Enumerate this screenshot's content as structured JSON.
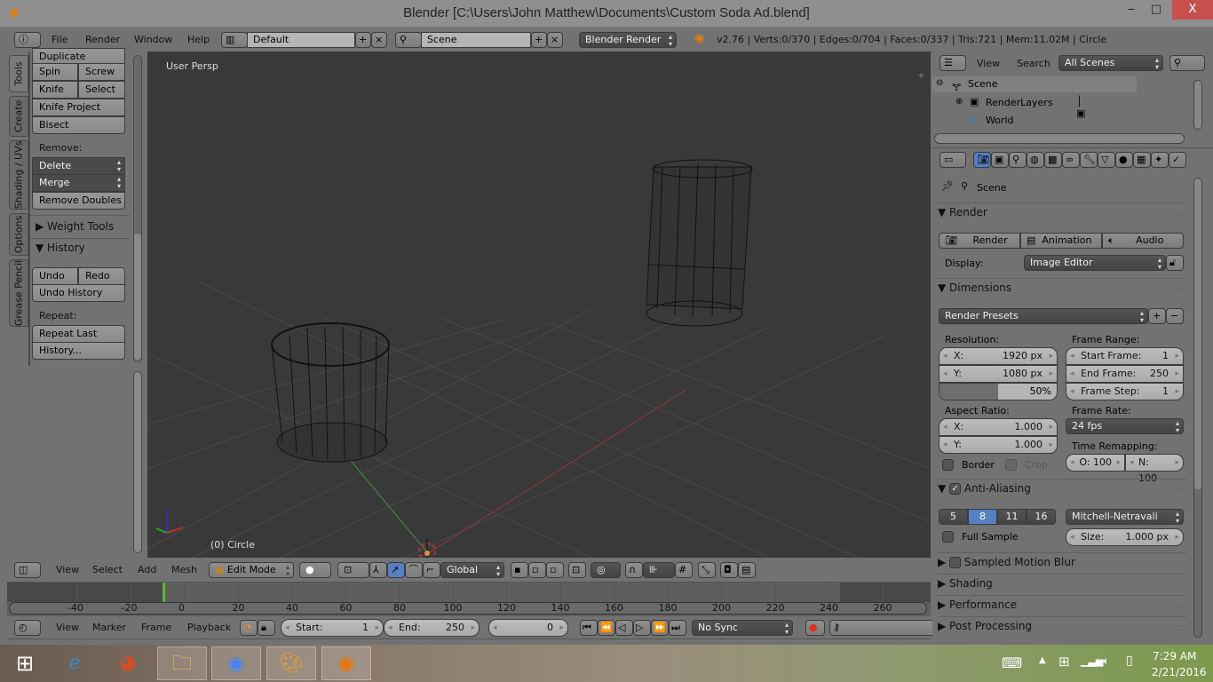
{
  "window": {
    "title": "Blender [C:\\Users\\John Matthew\\Documents\\Custom Soda Ad.blend]",
    "minimize": "‒",
    "maximize": "□",
    "close": "X"
  },
  "info_header": {
    "menus": [
      "File",
      "Render",
      "Window",
      "Help"
    ],
    "screen_layout": "Default",
    "scene": "Scene",
    "engine": "Blender Render",
    "stats": "v2.76 | Verts:0/370 | Edges:0/704 | Faces:0/337 | Tris:721 | Mem:11.02M | Circle"
  },
  "toolshelf": {
    "tabs": [
      "Tools",
      "Create",
      "Shading / UVs",
      "Options",
      "Grease Pencil"
    ],
    "buttons": {
      "duplicate": "Duplicate",
      "spin": "Spin",
      "screw": "Screw",
      "knife": "Knife",
      "select": "Select",
      "knife_project": "Knife Project",
      "bisect": "Bisect"
    },
    "remove_label": "Remove:",
    "delete": "Delete",
    "merge": "Merge",
    "remove_doubles": "Remove Doubles",
    "weight_tools": "Weight Tools",
    "history": "History",
    "undo": "Undo",
    "redo": "Redo",
    "undo_history": "Undo History",
    "repeat_label": "Repeat:",
    "repeat_last": "Repeat Last",
    "history_dots": "History..."
  },
  "viewport": {
    "view_label": "User Persp",
    "object_label": "(0) Circle"
  },
  "view3d_header": {
    "menus": [
      "View",
      "Select",
      "Add",
      "Mesh"
    ],
    "mode": "Edit Mode",
    "orientation": "Global"
  },
  "timeline": {
    "ticks": [
      "-40",
      "-20",
      "0",
      "20",
      "40",
      "60",
      "80",
      "100",
      "120",
      "140",
      "160",
      "180",
      "200",
      "220",
      "240",
      "260"
    ],
    "current_frame": "0",
    "menus": [
      "View",
      "Marker",
      "Frame",
      "Playback"
    ],
    "start_label": "Start:",
    "start": "1",
    "end_label": "End:",
    "end": "250",
    "sync": "No Sync"
  },
  "outliner": {
    "menus": [
      "View",
      "Search"
    ],
    "filter": "All Scenes",
    "items": [
      "Scene",
      "RenderLayers",
      "World"
    ]
  },
  "properties": {
    "context": "Scene",
    "render": {
      "title": "Render",
      "render_btn": "Render",
      "animation_btn": "Animation",
      "audio_btn": "Audio",
      "display_label": "Display:",
      "display": "Image Editor"
    },
    "dimensions": {
      "title": "Dimensions",
      "presets": "Render Presets",
      "resolution_label": "Resolution:",
      "res_x_label": "X:",
      "res_x": "1920 px",
      "res_y_label": "Y:",
      "res_y": "1080 px",
      "res_pct": "50%",
      "res_pct_value": 0.5,
      "frame_range_label": "Frame Range:",
      "start_label": "Start Frame:",
      "start": "1",
      "end_label": "End Frame:",
      "end": "250",
      "step_label": "Frame Step:",
      "step": "1",
      "aspect_label": "Aspect Ratio:",
      "asp_x_label": "X:",
      "asp_x": "1.000",
      "asp_y_label": "Y:",
      "asp_y": "1.000",
      "frame_rate_label": "Frame Rate:",
      "frame_rate": "24 fps",
      "time_remap_label": "Time Remapping:",
      "old": "O: 100",
      "new": "N: 100",
      "border": "Border",
      "crop": "Crop"
    },
    "anti_aliasing": {
      "title": "Anti-Aliasing",
      "samples": [
        "5",
        "8",
        "11",
        "16"
      ],
      "selected": "8",
      "filter": "Mitchell-Netravali",
      "full_sample": "Full Sample",
      "size_label": "Size:",
      "size": "1.000 px"
    },
    "collapsed": [
      "Sampled Motion Blur",
      "Shading",
      "Performance",
      "Post Processing"
    ]
  },
  "taskbar": {
    "time": "7:29 AM",
    "date": "2/21/2016"
  },
  "colors": {
    "accent": "#5680c2",
    "playhead": "#5cb531",
    "close": "#c7504f"
  }
}
